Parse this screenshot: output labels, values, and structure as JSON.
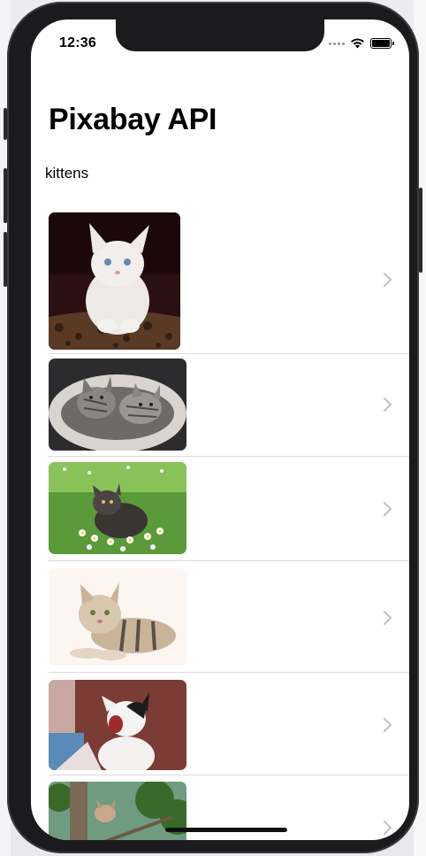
{
  "status_bar": {
    "time": "12:36"
  },
  "nav": {
    "title": "Pixabay API"
  },
  "search": {
    "value": "kittens"
  },
  "results": [
    {
      "subject": "white kitten in leopard basket"
    },
    {
      "subject": "two tabby kittens in bed"
    },
    {
      "subject": "kitten in grass with daisies"
    },
    {
      "subject": "tabby kitten lying down"
    },
    {
      "subject": "yawning black and white kitten"
    },
    {
      "subject": "kitten in tree"
    }
  ],
  "colors": {
    "chevron": "#c4c4c7",
    "separator": "#dcdcdf"
  }
}
